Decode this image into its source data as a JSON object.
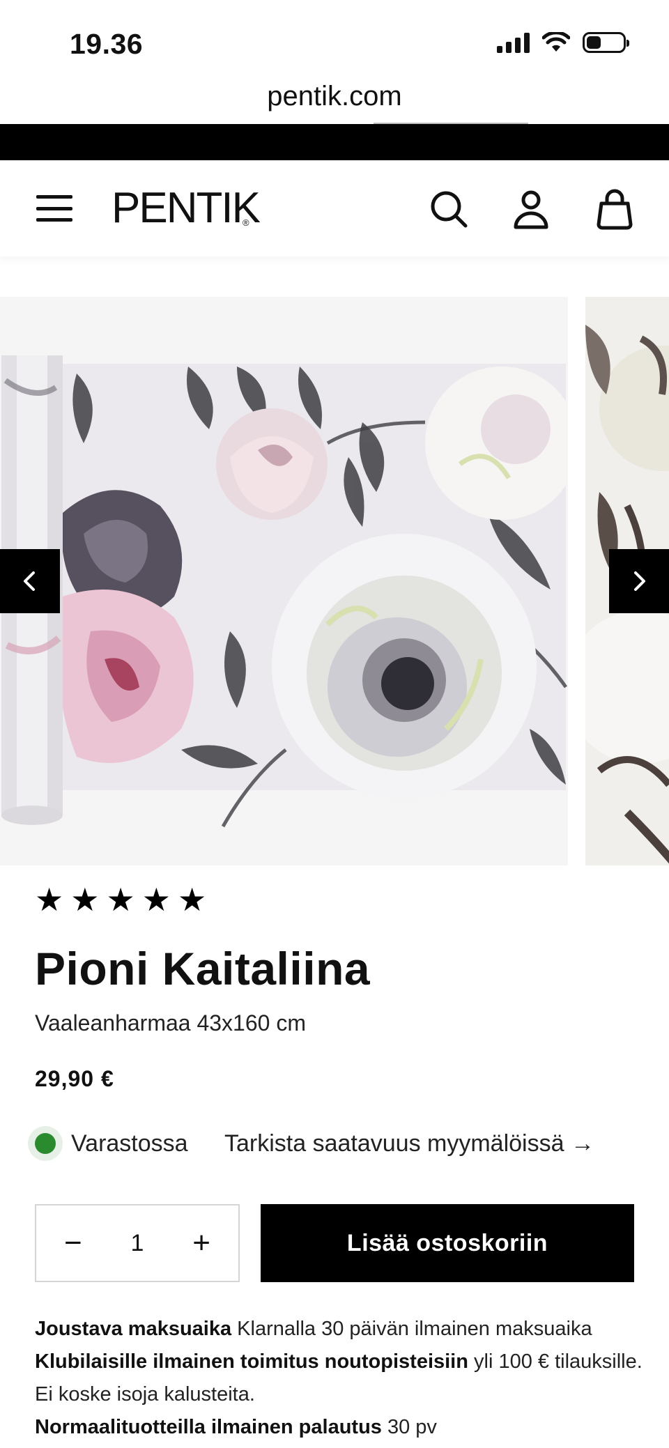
{
  "status_bar": {
    "time": "19.36",
    "icons": [
      "signal-icon",
      "wifi-icon",
      "battery-icon"
    ]
  },
  "browser": {
    "url": "pentik.com"
  },
  "header": {
    "logo": "PENTIK",
    "logo_mark": "®",
    "icons": [
      "menu-icon",
      "search-icon",
      "account-icon",
      "bag-icon"
    ]
  },
  "gallery": {
    "prev_icon": "chevron-left-icon",
    "next_icon": "chevron-right-icon"
  },
  "product": {
    "rating": 5,
    "stars": [
      "★",
      "★",
      "★",
      "★",
      "★"
    ],
    "title": "Pioni Kaitaliina",
    "variant": "Vaaleanharmaa 43x160 cm",
    "price": "29,90 €",
    "stock_status": "Varastossa",
    "stock_color": "#2a8a2e",
    "store_link": "Tarkista saatavuus myymälöissä →"
  },
  "purchase": {
    "qty_minus": "−",
    "qty_value": "1",
    "qty_plus": "+",
    "add_to_cart": "Lisää ostoskoriin"
  },
  "info": {
    "line1_bold": "Joustava maksuaika",
    "line1_text": " Klarnalla 30 päivän ilmainen maksuaika",
    "line2_bold": "Klubilaisille ilmainen toimitus noutopisteisiin",
    "line2_text": " yli 100 € tilauksille. Ei koske isoja kalusteita.",
    "line3_bold": "Normaalituotteilla ilmainen palautus",
    "line3_text": " 30 pv"
  }
}
